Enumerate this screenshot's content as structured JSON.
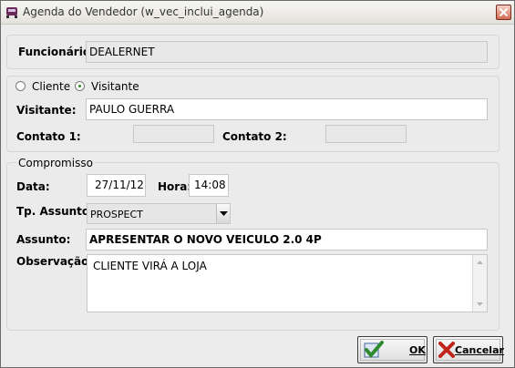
{
  "window": {
    "title": "Agenda do Vendedor (w_vec_inclui_agenda)"
  },
  "funcionario": {
    "label": "Funcionário:",
    "value": "DEALERNET"
  },
  "tipo": {
    "cliente_label": "Cliente",
    "visitante_label": "Visitante",
    "selected": "Visitante"
  },
  "visitante": {
    "label": "Visitante:",
    "value": "PAULO GUERRA"
  },
  "contato1": {
    "label": "Contato 1:",
    "value": ""
  },
  "contato2": {
    "label": "Contato 2:",
    "value": ""
  },
  "compromisso": {
    "group_title": "Compromisso",
    "data_label": "Data:",
    "data_value": "27/11/12",
    "hora_label": "Hora:",
    "hora_value": "14:08",
    "tp_assunto_label": "Tp. Assunto:",
    "tp_assunto_value": "PROSPECT",
    "assunto_label": "Assunto:",
    "assunto_value": "APRESENTAR O NOVO VEICULO 2.0 4P",
    "observacao_label": "Observação:",
    "observacao_value": "CLIENTE VIRÁ A LOJA"
  },
  "buttons": {
    "ok_label": "OK",
    "cancelar_label": "Cancelar"
  },
  "icons": {
    "title": "app-car-icon",
    "close": "close-icon",
    "ok": "check-icon",
    "cancel": "x-icon"
  },
  "colors": {
    "ok_check": "#2f8a2f",
    "cancel_x": "#c0241a",
    "close_button": "#d06a52"
  }
}
